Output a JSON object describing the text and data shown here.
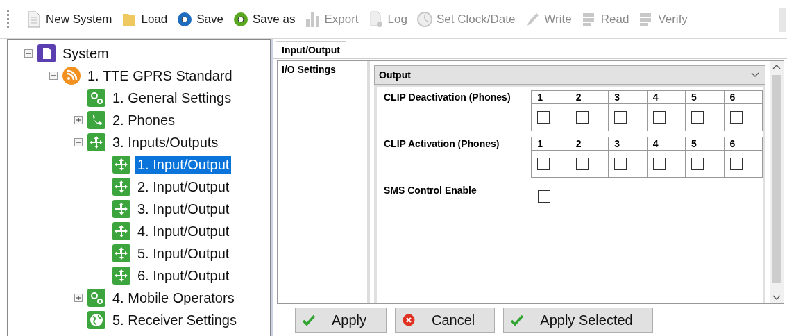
{
  "toolbar": [
    {
      "label": "New System",
      "kind": "new",
      "disabled": false
    },
    {
      "label": "Load",
      "kind": "load",
      "disabled": false
    },
    {
      "label": "Save",
      "kind": "save",
      "disabled": false
    },
    {
      "label": "Save as",
      "kind": "saveas",
      "disabled": false
    },
    {
      "label": "Export",
      "kind": "export",
      "disabled": true
    },
    {
      "label": "Log",
      "kind": "log",
      "disabled": true
    },
    {
      "label": "Set Clock/Date",
      "kind": "clock",
      "disabled": true
    },
    {
      "label": "Write",
      "kind": "write",
      "disabled": true
    },
    {
      "label": "Read",
      "kind": "read",
      "disabled": true
    },
    {
      "label": "Verify",
      "kind": "verify",
      "disabled": true
    }
  ],
  "tree": [
    {
      "label": "System",
      "kind": "system",
      "expanded": true,
      "selected": false,
      "children": [
        {
          "label": "1. TTE GPRS Standard",
          "kind": "device",
          "expanded": true,
          "selected": false,
          "children": [
            {
              "label": "1. General Settings",
              "kind": "gears",
              "selected": false
            },
            {
              "label": "2. Phones",
              "kind": "phone",
              "expanded": false,
              "selected": false
            },
            {
              "label": "3. Inputs/Outputs",
              "kind": "io",
              "expanded": true,
              "selected": false,
              "children": [
                {
                  "label": "1. Input/Output",
                  "kind": "io",
                  "selected": true
                },
                {
                  "label": "2. Input/Output",
                  "kind": "io",
                  "selected": false
                },
                {
                  "label": "3. Input/Output",
                  "kind": "io",
                  "selected": false
                },
                {
                  "label": "4. Input/Output",
                  "kind": "io",
                  "selected": false
                },
                {
                  "label": "5. Input/Output",
                  "kind": "io",
                  "selected": false
                },
                {
                  "label": "6. Input/Output",
                  "kind": "io",
                  "selected": false
                }
              ]
            },
            {
              "label": "4. Mobile Operators",
              "kind": "gears",
              "expanded": false,
              "selected": false
            },
            {
              "label": "5. Receiver Settings",
              "kind": "globe",
              "selected": false
            }
          ]
        }
      ]
    }
  ],
  "tabs": [
    {
      "label": "Input/Output",
      "selected": true
    }
  ],
  "side_tab": {
    "label": "I/O Settings"
  },
  "mode_select": {
    "value": "Output"
  },
  "settings": [
    {
      "kind": "grid",
      "label": "CLIP Deactivation (Phones)",
      "columns": [
        {
          "label": "1",
          "checked": false
        },
        {
          "label": "2",
          "checked": false
        },
        {
          "label": "3",
          "checked": false
        },
        {
          "label": "4",
          "checked": false
        },
        {
          "label": "5",
          "checked": false
        },
        {
          "label": "6",
          "checked": false
        }
      ]
    },
    {
      "kind": "grid",
      "label": "CLIP Activation (Phones)",
      "columns": [
        {
          "label": "1",
          "checked": false
        },
        {
          "label": "2",
          "checked": false
        },
        {
          "label": "3",
          "checked": false
        },
        {
          "label": "4",
          "checked": false
        },
        {
          "label": "5",
          "checked": false
        },
        {
          "label": "6",
          "checked": false
        }
      ]
    },
    {
      "kind": "single",
      "label": "SMS Control Enable",
      "checked": false
    }
  ],
  "buttons": [
    {
      "label": "Apply",
      "kind": "ok"
    },
    {
      "label": "Cancel",
      "kind": "cancel"
    },
    {
      "label": "Apply Selected",
      "kind": "ok"
    }
  ]
}
